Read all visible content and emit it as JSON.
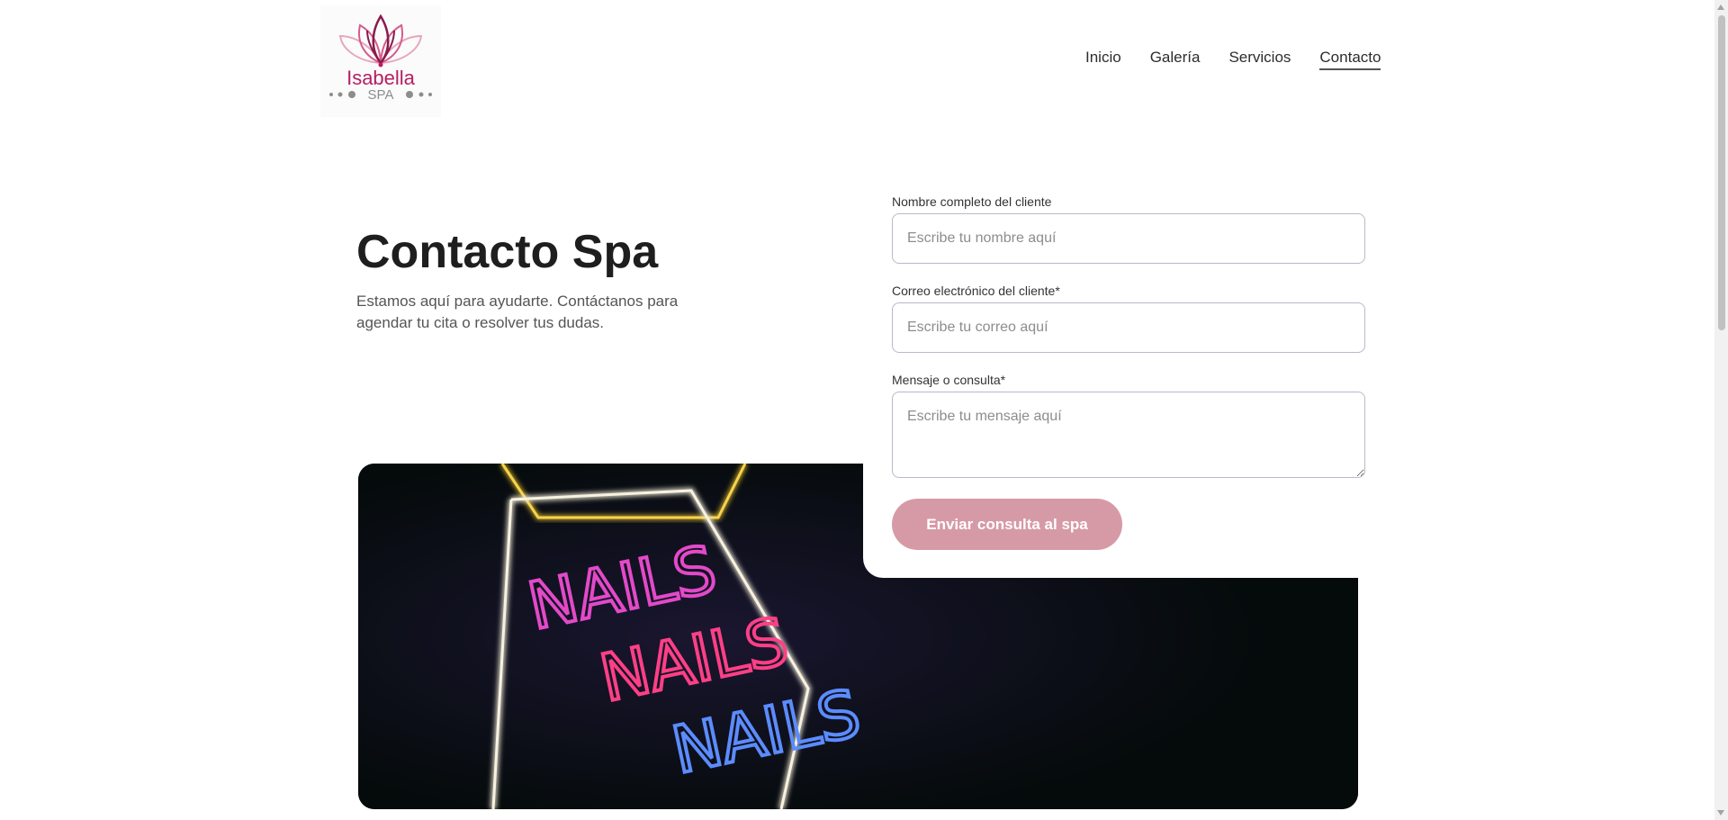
{
  "header": {
    "logo": {
      "name": "Isabella",
      "sub": "SPA",
      "icon": "lotus-icon",
      "colors": {
        "primary": "#b51f63",
        "petal": "#e8a7bc",
        "gray": "#8d8d8d"
      }
    },
    "nav": [
      {
        "label": "Inicio",
        "active": false
      },
      {
        "label": "Galería",
        "active": false
      },
      {
        "label": "Servicios",
        "active": false
      },
      {
        "label": "Contacto",
        "active": true
      }
    ]
  },
  "hero": {
    "title": "Contacto Spa",
    "description": "Estamos aquí para ayudarte. Contáctanos para agendar tu cita o resolver tus dudas.",
    "image": {
      "subject": "neon-nails-sign",
      "sign_text": "NAILS"
    }
  },
  "form": {
    "name_label": "Nombre completo del cliente",
    "name_placeholder": "Escribe tu nombre aquí",
    "email_label": "Correo electrónico del cliente*",
    "email_placeholder": "Escribe tu correo aquí",
    "message_label": "Mensaje o consulta*",
    "message_placeholder": "Escribe tu mensaje aquí",
    "submit_label": "Enviar consulta al spa"
  },
  "colors": {
    "button": "#d69aa6",
    "text_dark": "#1e1e1e",
    "text_muted": "#555555",
    "input_border": "#b9b9c9"
  }
}
